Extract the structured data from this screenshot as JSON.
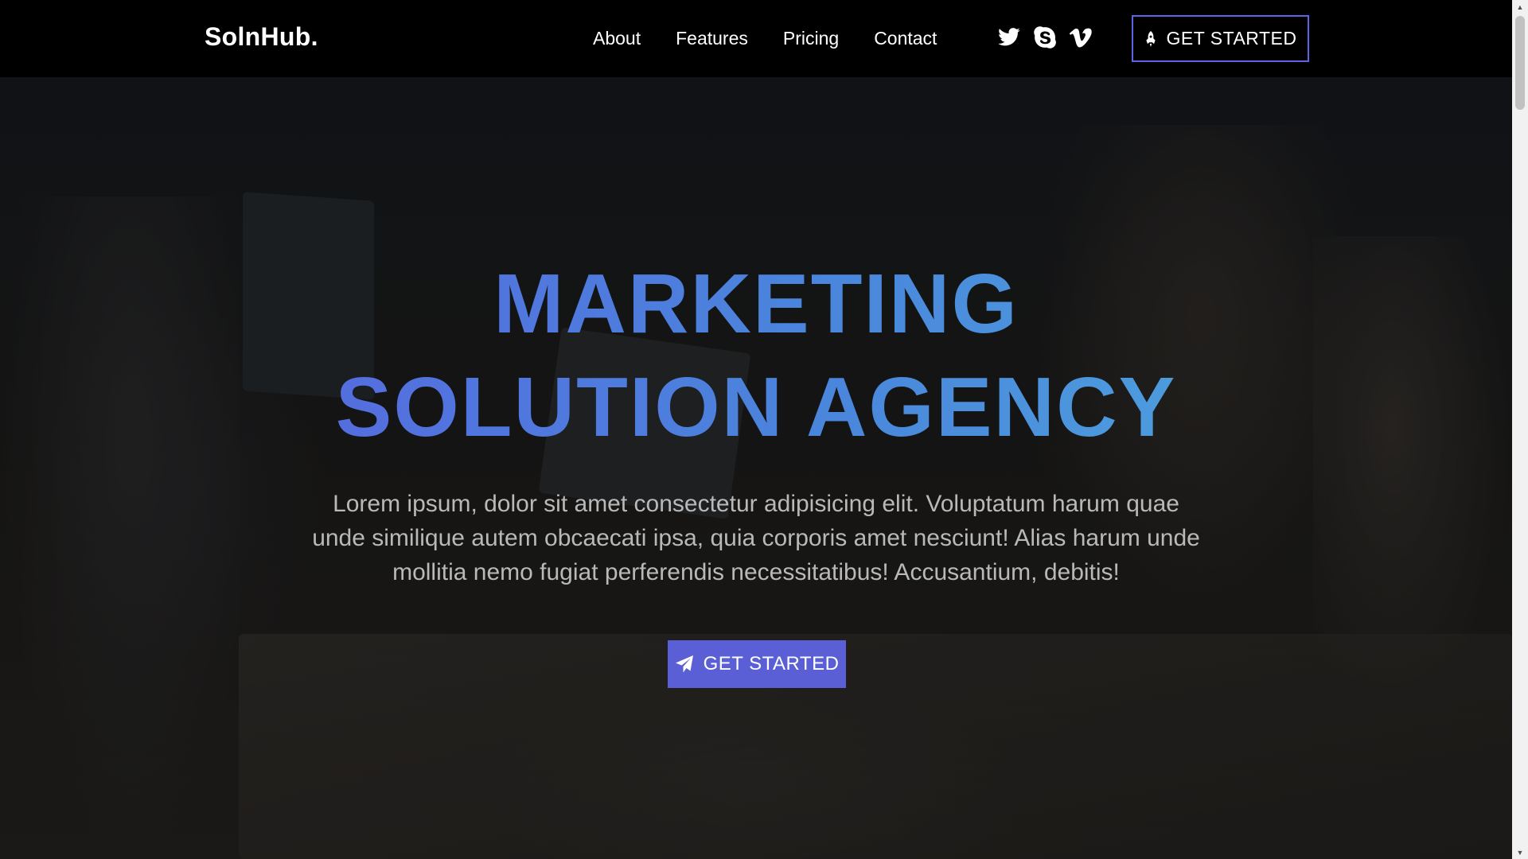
{
  "header": {
    "logo": "SolnHub.",
    "nav": [
      "About",
      "Features",
      "Pricing",
      "Contact"
    ],
    "socials": [
      "twitter-icon",
      "skype-icon",
      "vimeo-icon"
    ],
    "cta_label": "GET STARTED"
  },
  "hero": {
    "title_line1": "MARKETING",
    "title_line2": "SOLUTION AGENCY",
    "description": "Lorem ipsum, dolor sit amet consectetur adipisicing elit. Voluptatum harum quae unde similique autem obcaecati ipsa, quia corporis amet nesciunt! Alias harum unde mollitia nemo fugiat perferendis necessitatibus! Accusantium, debitis!",
    "cta_label": "GET STARTED",
    "cta_icon": "paper-plane-icon"
  },
  "colors": {
    "accent": "#5a5fd6",
    "title_gradient_start": "#5a5ee0",
    "title_gradient_end": "#4fb0de",
    "header_bg": "#000000"
  }
}
